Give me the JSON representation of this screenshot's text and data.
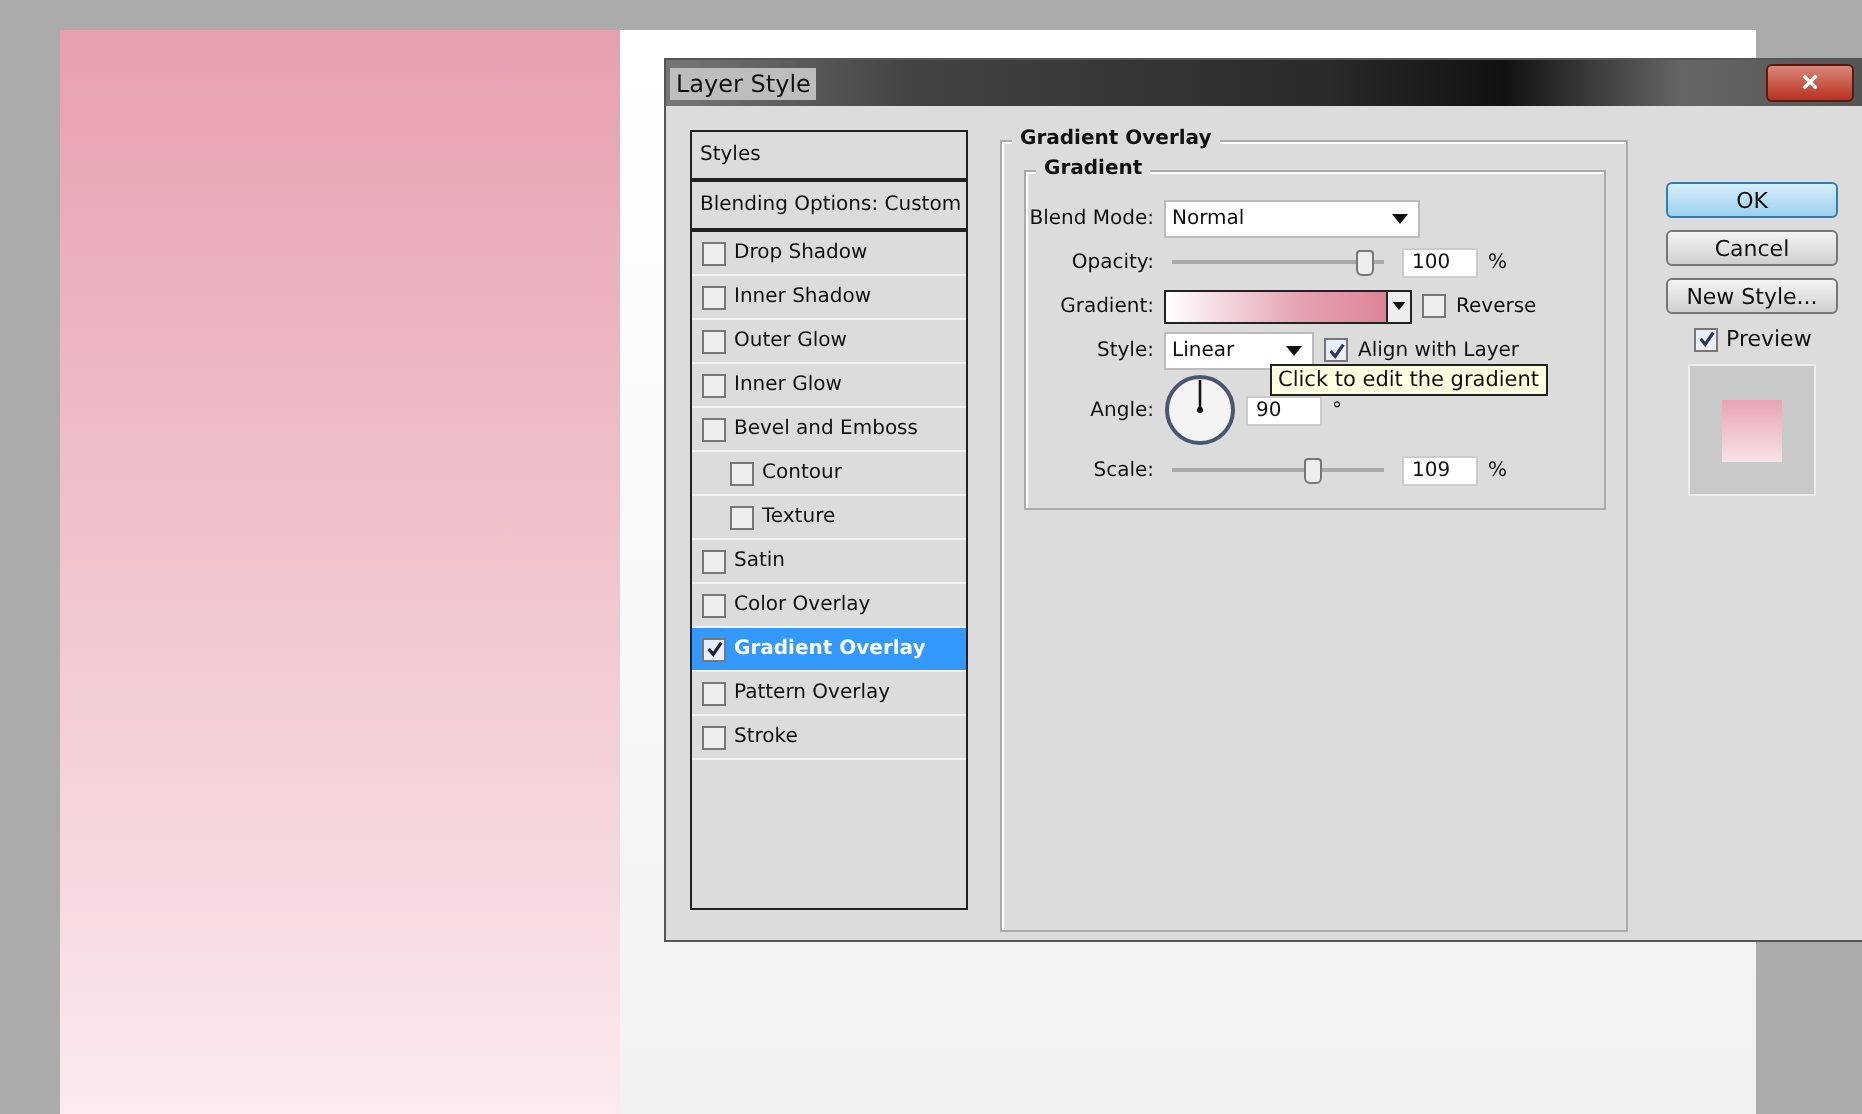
{
  "dialog": {
    "title": "Layer Style",
    "close": "×"
  },
  "styles_list": [
    {
      "kind": "header",
      "label": "Styles"
    },
    {
      "kind": "header",
      "label": "Blending Options: Custom"
    },
    {
      "kind": "effect",
      "label": "Drop Shadow",
      "checked": false,
      "selected": false
    },
    {
      "kind": "effect",
      "label": "Inner Shadow",
      "checked": false,
      "selected": false
    },
    {
      "kind": "effect",
      "label": "Outer Glow",
      "checked": false,
      "selected": false
    },
    {
      "kind": "effect",
      "label": "Inner Glow",
      "checked": false,
      "selected": false
    },
    {
      "kind": "effect",
      "label": "Bevel and Emboss",
      "checked": false,
      "selected": false,
      "children": [
        {
          "kind": "effect",
          "label": "Contour",
          "checked": false,
          "selected": false
        },
        {
          "kind": "effect",
          "label": "Texture",
          "checked": false,
          "selected": false
        }
      ]
    },
    {
      "kind": "effect",
      "label": "Satin",
      "checked": false,
      "selected": false
    },
    {
      "kind": "effect",
      "label": "Color Overlay",
      "checked": false,
      "selected": false
    },
    {
      "kind": "effect",
      "label": "Gradient Overlay",
      "checked": true,
      "selected": true
    },
    {
      "kind": "effect",
      "label": "Pattern Overlay",
      "checked": false,
      "selected": false
    },
    {
      "kind": "effect",
      "label": "Stroke",
      "checked": false,
      "selected": false
    }
  ],
  "panel": {
    "title": "Gradient Overlay",
    "group": "Gradient",
    "blend_mode": {
      "label": "Blend Mode:",
      "value": "Normal"
    },
    "opacity": {
      "label": "Opacity:",
      "level": 0.95,
      "value": "100",
      "unit": "%"
    },
    "gradient": {
      "label": "Gradient:",
      "reverse": {
        "label": "Reverse",
        "checked": false
      }
    },
    "style": {
      "label": "Style:",
      "value": "Linear",
      "align": {
        "label": "Align with Layer",
        "checked": true
      }
    },
    "angle": {
      "label": "Angle:",
      "value": "90",
      "unit": "°"
    },
    "scale": {
      "label": "Scale:",
      "level": 0.68,
      "value": "109",
      "unit": "%"
    },
    "tooltip": "Click to edit the gradient"
  },
  "buttons": [
    {
      "label": "OK",
      "default": true
    },
    {
      "label": "Cancel",
      "default": false
    },
    {
      "label": "New Style...",
      "default": false
    }
  ],
  "preview": {
    "label": "Preview",
    "checked": true
  }
}
